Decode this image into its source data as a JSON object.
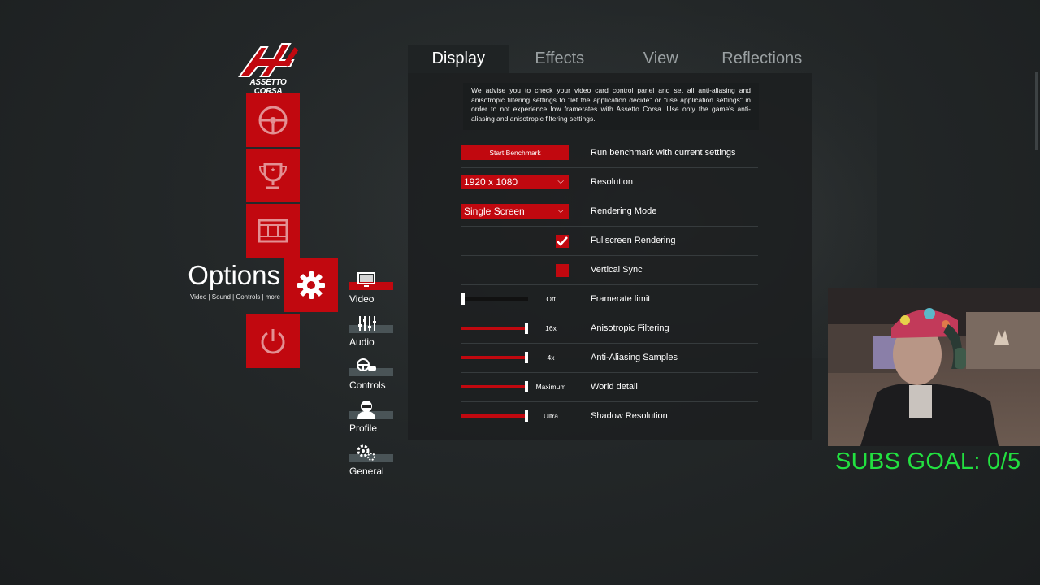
{
  "logo": {
    "text": "ASSETTO CORSA"
  },
  "main_menu": {
    "title": "Options",
    "subtitle": "Video | Sound | Controls | more",
    "tiles": [
      {
        "name": "drive",
        "icon": "steering-wheel-icon"
      },
      {
        "name": "special-events",
        "icon": "trophy-icon"
      },
      {
        "name": "replays",
        "icon": "film-strip-icon"
      },
      {
        "name": "options",
        "icon": "gear-icon"
      },
      {
        "name": "quit",
        "icon": "power-icon"
      }
    ]
  },
  "sub_nav": [
    {
      "label": "Video",
      "icon": "monitor-icon",
      "active": true
    },
    {
      "label": "Audio",
      "icon": "mixer-sliders-icon",
      "active": false
    },
    {
      "label": "Controls",
      "icon": "controller-icon",
      "active": false
    },
    {
      "label": "Profile",
      "icon": "driver-helmet-icon",
      "active": false
    },
    {
      "label": "General",
      "icon": "gears-icon",
      "active": false
    }
  ],
  "tabs": [
    {
      "label": "Display",
      "active": true
    },
    {
      "label": "Effects",
      "active": false
    },
    {
      "label": "View",
      "active": false
    },
    {
      "label": "Reflections",
      "active": false
    }
  ],
  "advice": "We advise you to check your video card control panel and set all anti-aliasing and anisotropic filtering settings to \"let the application decide\" or \"use application settings\" in order to not experience low framerates with Assetto Corsa. Use only the game's anti-aliasing and anisotropic filtering settings.",
  "settings": {
    "benchmark": {
      "button": "Start Benchmark",
      "label": "Run benchmark with current settings"
    },
    "resolution": {
      "value": "1920 x 1080",
      "label": "Resolution"
    },
    "rendering_mode": {
      "value": "Single Screen",
      "label": "Rendering Mode"
    },
    "fullscreen": {
      "label": "Fullscreen Rendering",
      "checked": true
    },
    "vsync": {
      "label": "Vertical Sync",
      "checked": false
    },
    "framerate_limit": {
      "label": "Framerate limit",
      "value_text": "Off",
      "level": 0.0
    },
    "anisotropic": {
      "label": "Anisotropic Filtering",
      "value_text": "16x",
      "level": 1.0
    },
    "antialiasing": {
      "label": "Anti-Aliasing Samples",
      "value_text": "4x",
      "level": 1.0
    },
    "world_detail": {
      "label": "World detail",
      "value_text": "Maximum",
      "level": 1.0
    },
    "shadow_resolution": {
      "label": "Shadow Resolution",
      "value_text": "Ultra",
      "level": 1.0
    }
  },
  "overlay": {
    "subs_goal": "SUBS GOAL: 0/5"
  },
  "colors": {
    "accent_red": "#c1080f",
    "subs_goal_green": "#22e040",
    "inactive_tab": "#9aa0a2"
  }
}
